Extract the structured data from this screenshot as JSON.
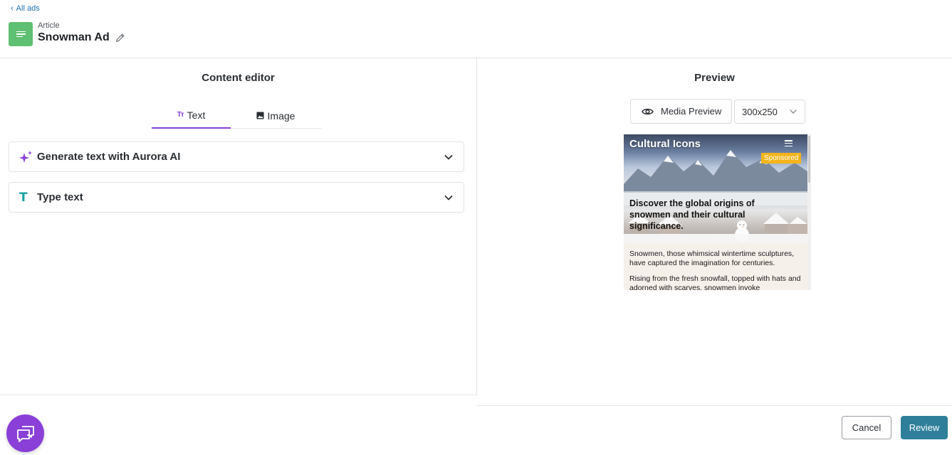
{
  "nav": {
    "back_label": "All ads"
  },
  "ad": {
    "type": "Article",
    "name": "Snowman Ad"
  },
  "editor": {
    "title": "Content editor",
    "tabs": [
      {
        "label": "Text",
        "active": true
      },
      {
        "label": "Image",
        "active": false
      }
    ],
    "accordions": [
      {
        "label": "Generate text with Aurora AI",
        "icon": "sparkle-icon"
      },
      {
        "label": "Type text",
        "icon": "text-t-icon"
      }
    ]
  },
  "preview": {
    "title": "Preview",
    "media_preview_label": "Media Preview",
    "size_selected": "300x250",
    "ad": {
      "brand": "Cultural Icons",
      "sponsored": "Sponsored",
      "headline": "Discover the global origins of snowmen and their cultural significance.",
      "body": [
        "Snowmen, those whimsical wintertime sculptures, have captured the imagination for centuries.",
        "Rising from the fresh snowfall, topped with hats and adorned with scarves, snowmen invoke"
      ]
    }
  },
  "footer": {
    "cancel_label": "Cancel",
    "review_label": "Review"
  },
  "colors": {
    "accent": "#8a3fd8",
    "primary_button": "#2f7f9b",
    "doc_icon": "#5fbf72",
    "link": "#1f6fb2",
    "sponsored": "#f4b41a"
  }
}
